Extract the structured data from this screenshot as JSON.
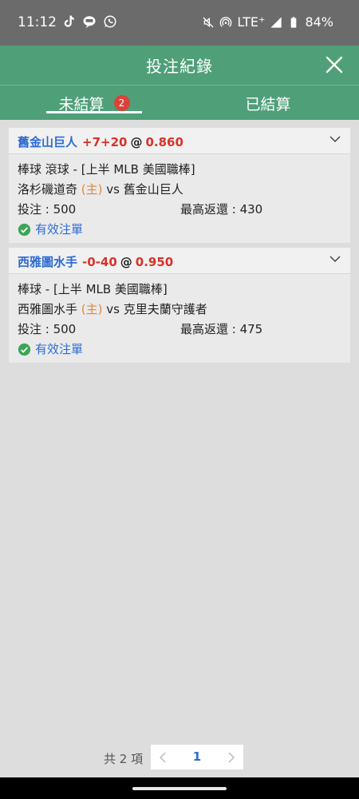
{
  "status_bar": {
    "time": "11:12",
    "battery": "84%",
    "network": "LTE⁺",
    "app_icons": [
      "tiktok-icon",
      "line-icon",
      "whatsapp-icon"
    ],
    "system_icons": [
      "mute-icon",
      "hotspot-icon",
      "signal-icon",
      "battery-icon"
    ]
  },
  "header": {
    "title": "投注紀錄",
    "close_icon": "close-icon"
  },
  "tabs": [
    {
      "label": "未結算",
      "badge": "2",
      "active": true
    },
    {
      "label": "已結算",
      "active": false
    }
  ],
  "bets": [
    {
      "team": "舊金山巨人",
      "line": "+7+20",
      "at": "@",
      "odds": "0.860",
      "category": "棒球 滾球 - [上半 MLB 美國職棒]",
      "home_team": "洛杉磯道奇",
      "home_tag": "(主)",
      "vs": "vs",
      "away_team": "舊金山巨人",
      "stake_label": "投注 : 500",
      "return_label": "最高返還 : 430",
      "status": "有效注單"
    },
    {
      "team": "西雅圖水手",
      "line": "-0-40",
      "at": "@",
      "odds": "0.950",
      "category": "棒球 - [上半 MLB 美國職棒]",
      "home_team": "西雅圖水手",
      "home_tag": "(主)",
      "vs": "vs",
      "away_team": "克里夫蘭守護者",
      "stake_label": "投注 : 500",
      "return_label": "最高返還 : 475",
      "status": "有效注單"
    }
  ],
  "pagination": {
    "total_label": "共 2 項",
    "current_page": "1"
  },
  "colors": {
    "header_bg": "#4f9f78",
    "status_bar_bg": "#6b6b6b",
    "team_blue": "#2c6bd4",
    "odds_red": "#d9332a",
    "home_orange": "#e0893a",
    "badge_red": "#d9443a",
    "valid_green": "#3aa657"
  }
}
